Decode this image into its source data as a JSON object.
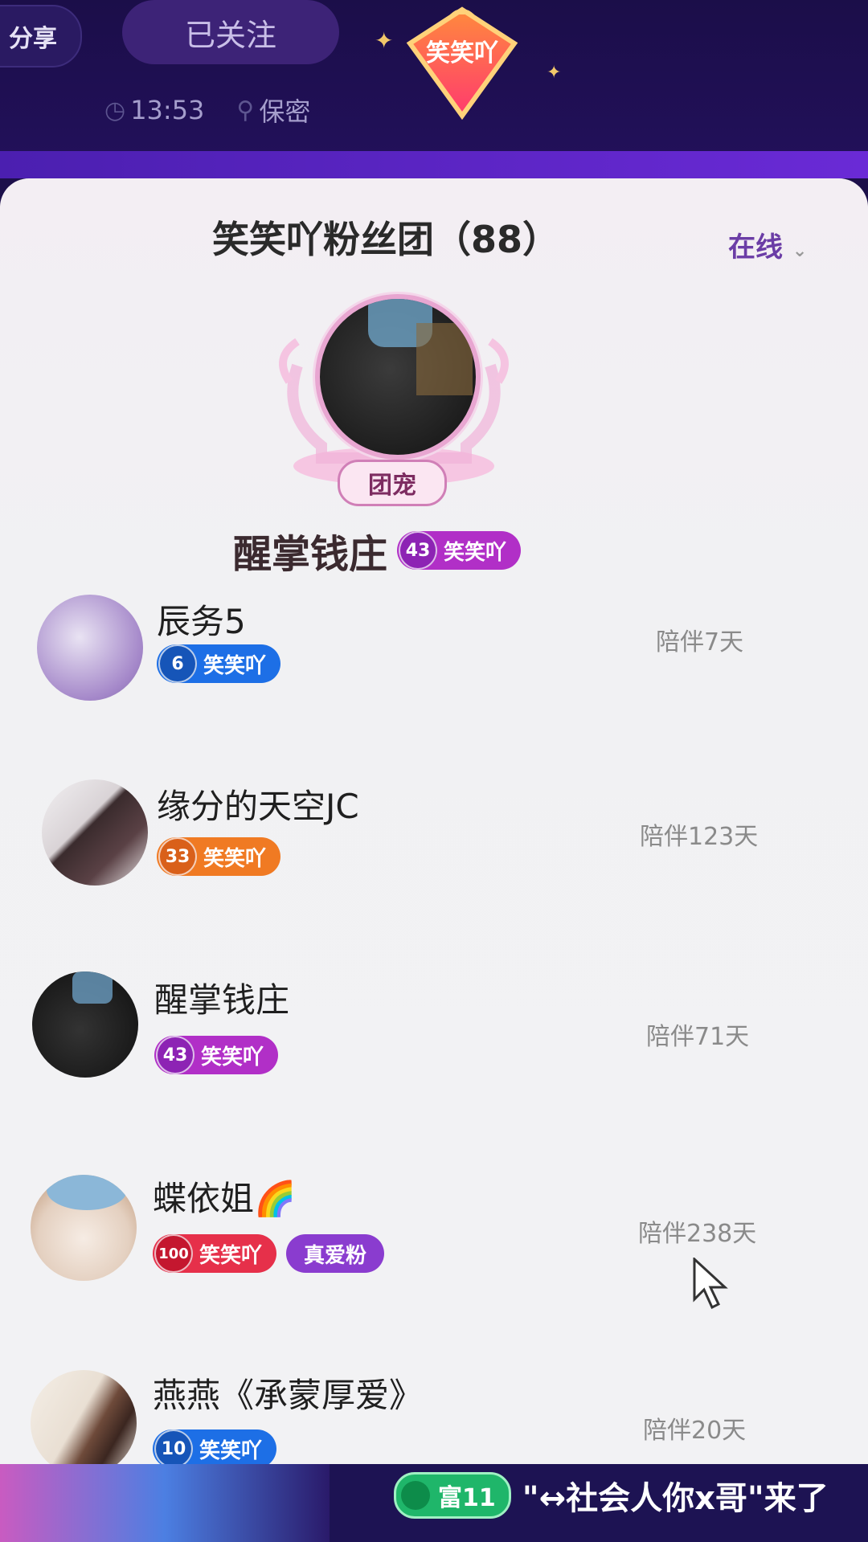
{
  "header": {
    "share_label": "分享",
    "follow_label": "已关注",
    "time": "13:53",
    "location": "保密",
    "badge_text": "笑笑吖"
  },
  "panel": {
    "title": "笑笑吖粉丝团（88）",
    "filter_label": "在线",
    "top_fan": {
      "tag": "团宠",
      "name": "醒掌钱庄",
      "level": "43",
      "group": "笑笑吖"
    }
  },
  "fans": [
    {
      "name": "辰务5",
      "level": "6",
      "group": "笑笑吖",
      "days": "陪伴7天",
      "color": "blue"
    },
    {
      "name": "缘分的天空JC",
      "level": "33",
      "group": "笑笑吖",
      "days": "陪伴123天",
      "color": "orange"
    },
    {
      "name": "醒掌钱庄",
      "level": "43",
      "group": "笑笑吖",
      "days": "陪伴71天",
      "color": "purple"
    },
    {
      "name": "蝶依姐🌈",
      "level": "100",
      "group": "笑笑吖",
      "days": "陪伴238天",
      "color": "red",
      "extra": "真爱粉"
    },
    {
      "name": "燕燕《承蒙厚爱》",
      "level": "10",
      "group": "笑笑吖",
      "days": "陪伴20天",
      "color": "blue"
    }
  ],
  "bottom": {
    "rich_label": "富11",
    "enter_text": "\"↔社会人你x哥\"来了"
  }
}
